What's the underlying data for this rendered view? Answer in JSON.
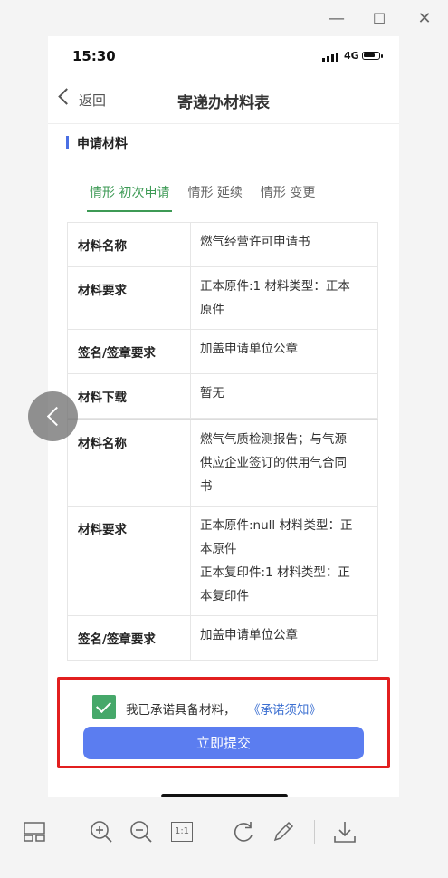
{
  "window_controls": {
    "minimize": "—",
    "maximize": "☐",
    "close": "✕"
  },
  "status": {
    "time": "15:30",
    "network": "4G"
  },
  "nav": {
    "back_label": "返回",
    "title": "寄递办材料表"
  },
  "section": {
    "title": "申请材料"
  },
  "tabs": [
    {
      "label": "情形 初次申请",
      "active": true
    },
    {
      "label": "情形 延续",
      "active": false
    },
    {
      "label": "情形 变更",
      "active": false
    }
  ],
  "table": [
    {
      "label": "材料名称",
      "value": [
        "燃气经营许可申请书"
      ]
    },
    {
      "label": "材料要求",
      "value": [
        "正本原件:1 材料类型：正本",
        "原件"
      ]
    },
    {
      "label": "签名/签章要求",
      "value": [
        "加盖申请单位公章"
      ]
    },
    {
      "label": "材料下载",
      "value": [
        "暂无"
      ]
    },
    {
      "label": "材料名称",
      "value": [
        "燃气气质检测报告；与气源",
        "供应企业签订的供用气合同",
        "书"
      ]
    },
    {
      "label": "材料要求",
      "value": [
        "正本原件:null 材料类型：正",
        "本原件",
        "正本复印件:1 材料类型：正",
        "本复印件"
      ]
    },
    {
      "label": "签名/签章要求",
      "value": [
        "加盖申请单位公章"
      ]
    }
  ],
  "agreement": {
    "checked": true,
    "text": "我已承诺具备材料，",
    "link": "《承诺须知》"
  },
  "submit_label": "立即提交",
  "toolbar": [
    "layout-icon",
    "zoom-in-icon",
    "zoom-out-icon",
    "actual-size-icon",
    "rotate-icon",
    "edit-pen-icon",
    "download-icon"
  ],
  "toolbar_actual_size_label": "1:1",
  "colors": {
    "accent_green": "#3d9a55",
    "button_blue": "#5b7df0",
    "link_blue": "#3b6fd1",
    "highlight_red": "#e21f1f"
  }
}
